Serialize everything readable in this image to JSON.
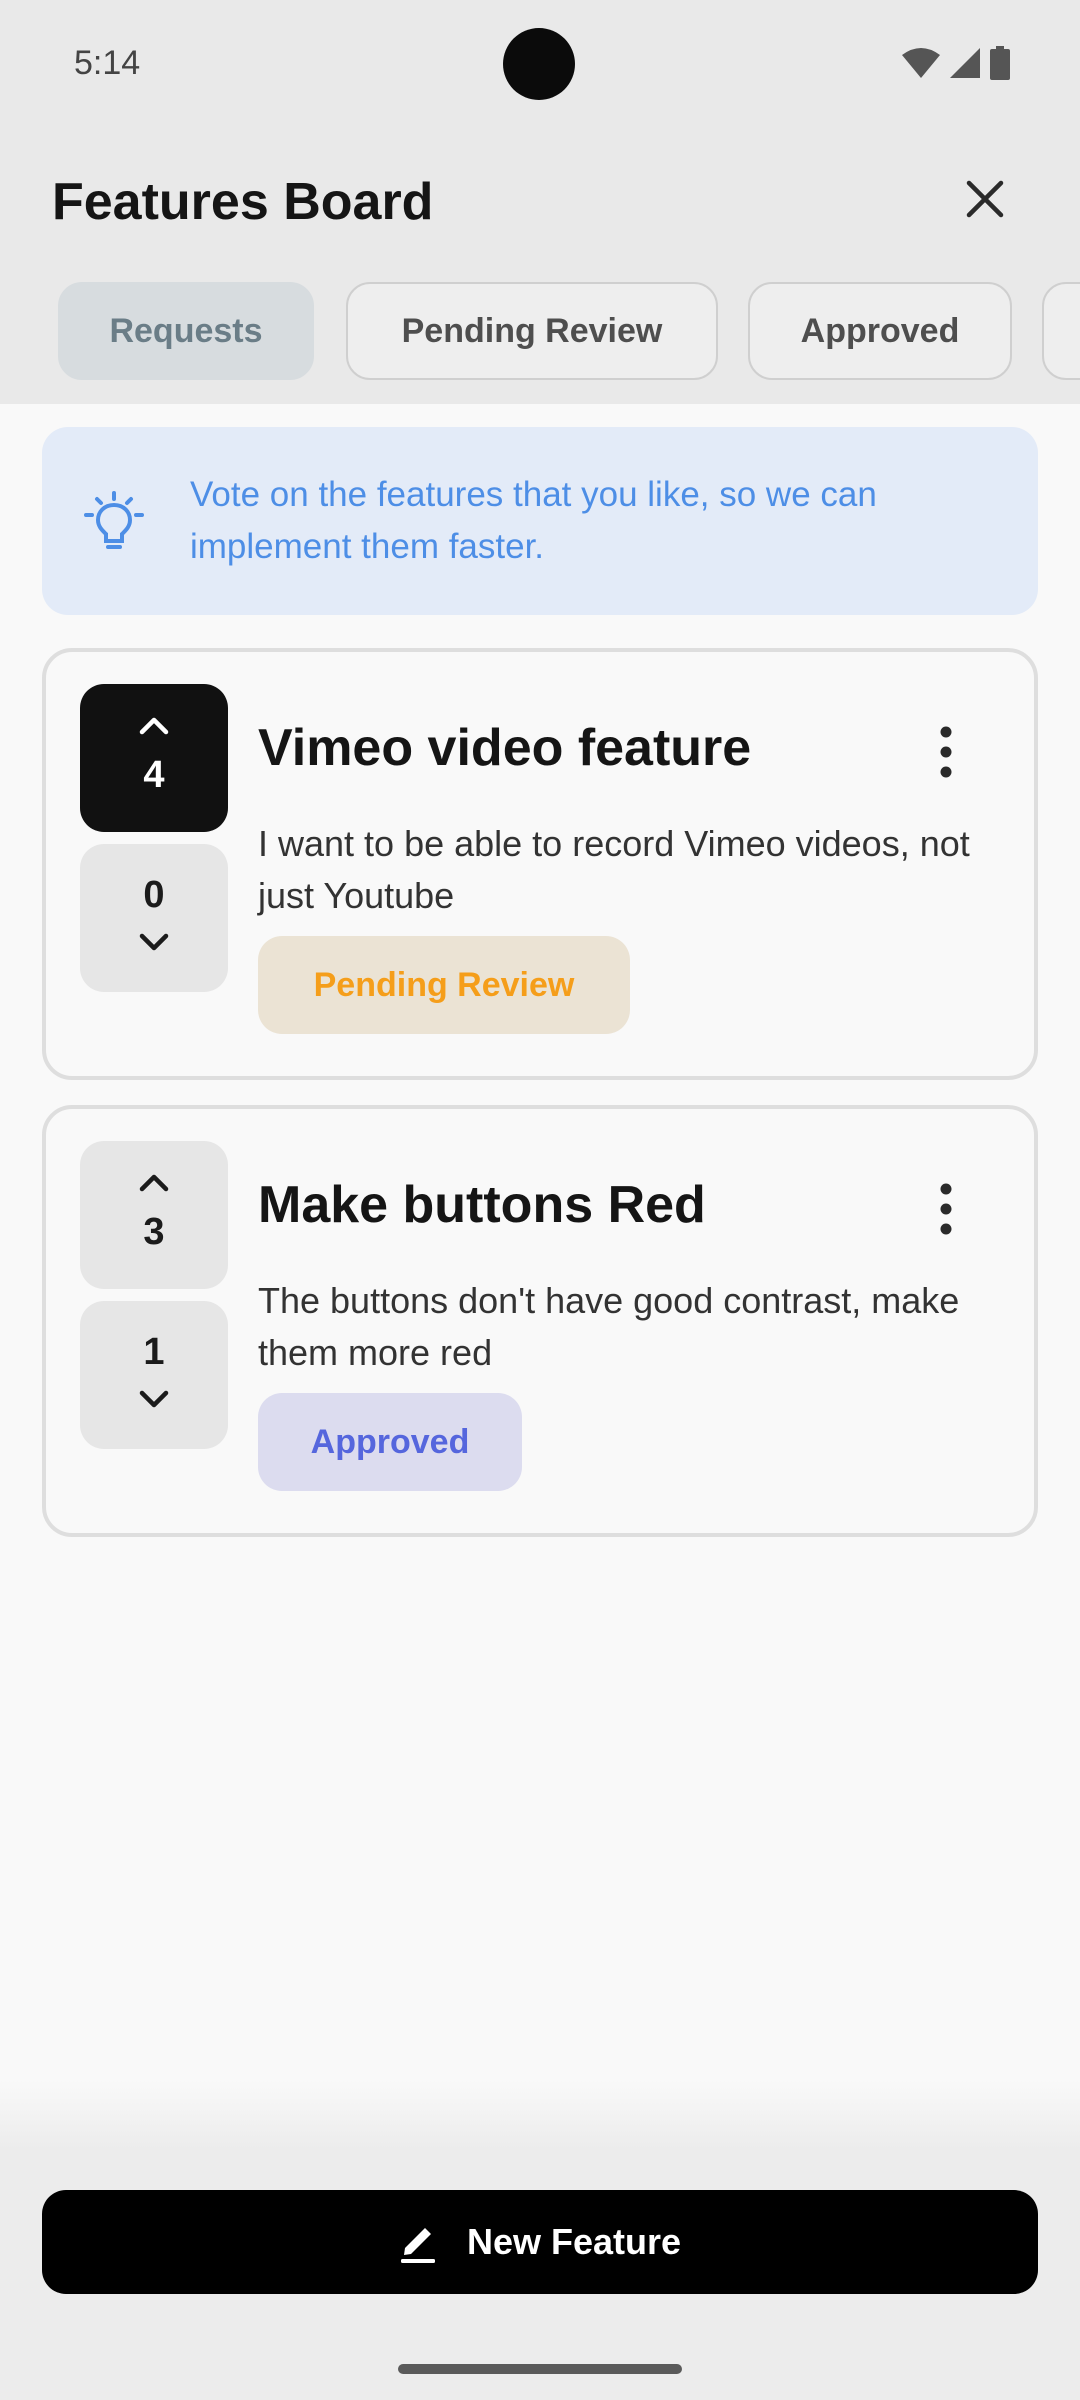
{
  "status_bar": {
    "time": "5:14"
  },
  "header": {
    "title": "Features Board"
  },
  "tabs": [
    {
      "label": "Requests",
      "active": true
    },
    {
      "label": "Pending Review",
      "active": false
    },
    {
      "label": "Approved",
      "active": false
    }
  ],
  "banner": {
    "text": "Vote on the features that you like, so we can implement them faster."
  },
  "features": [
    {
      "title": "Vimeo video feature",
      "description": "I want to be able to record Vimeo videos, not just Youtube",
      "upvotes": "4",
      "downvotes": "0",
      "upvoted": true,
      "status": "Pending Review"
    },
    {
      "title": "Make buttons Red",
      "description": "The buttons don't have good contrast, make them more red",
      "upvotes": "3",
      "downvotes": "1",
      "upvoted": false,
      "status": "Approved"
    }
  ],
  "actions": {
    "new_feature_label": "New Feature"
  },
  "colors": {
    "banner_text": "#4d8ee6",
    "pending_bg": "#ebe3d4",
    "pending_text": "#f59e1a",
    "approved_bg": "#dcdcef",
    "approved_text": "#5566dd"
  },
  "icons": [
    "close-icon",
    "lightbulb-icon",
    "chevron-up-icon",
    "chevron-down-icon",
    "more-vert-icon",
    "pencil-icon",
    "wifi-icon",
    "signal-icon",
    "battery-icon"
  ]
}
